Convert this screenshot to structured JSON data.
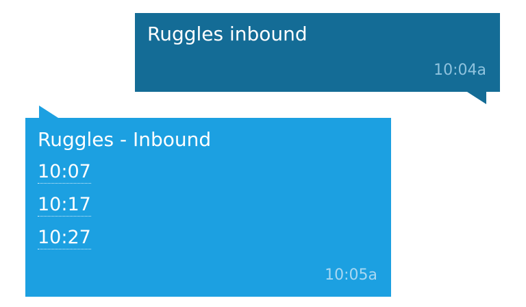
{
  "conversation": {
    "messages": [
      {
        "direction": "sent",
        "text": "Ruggles inbound",
        "time": "10:04a"
      },
      {
        "direction": "received",
        "text": "Ruggles - Inbound",
        "departures": [
          "10:07",
          "10:17",
          "10:27"
        ],
        "time": "10:05a"
      }
    ]
  },
  "colors": {
    "background": "#ffffff",
    "sent_bubble": "#146c96",
    "received_bubble": "#1ca0e1",
    "text": "#ffffff"
  }
}
